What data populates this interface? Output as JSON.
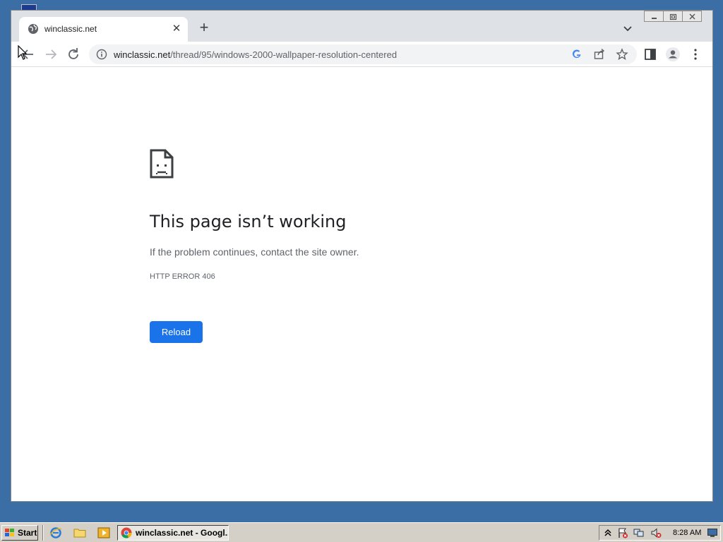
{
  "browser": {
    "tab": {
      "title": "winclassic.net"
    },
    "address": {
      "host": "winclassic.net",
      "path": "/thread/95/windows-2000-wallpaper-resolution-centered"
    }
  },
  "error_page": {
    "title": "This page isn’t working",
    "message": "If the problem continues, contact the site owner.",
    "code": "HTTP ERROR 406",
    "reload_label": "Reload"
  },
  "taskbar": {
    "start_label": "Start",
    "task_label": "winclassic.net - Googl...",
    "clock": "8:28 AM"
  },
  "colors": {
    "desktop": "#3a6ea5",
    "accent": "#1a73e8",
    "tab_strip": "#dee1e6"
  }
}
